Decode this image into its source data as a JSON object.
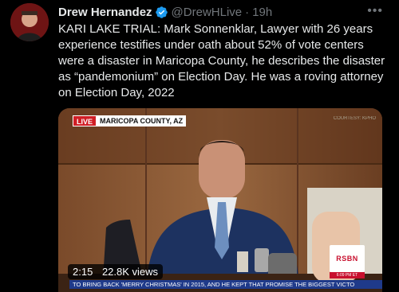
{
  "author": {
    "name": "Drew Hernandez",
    "handle": "@DrewHLive",
    "separator": "·",
    "time": "19h",
    "verified": true
  },
  "tweet": {
    "text": "KARI LAKE TRIAL: Mark Sonnenklar, Lawyer with 26 years experience testifies under oath about 52% of vote centers were a disaster in Maricopa County, he describes the disaster as “pandemonium” on Election Day. He was a roving attorney on Election Day, 2022"
  },
  "media": {
    "live_label": "LIVE",
    "location_label": "MARICOPA COUNTY, AZ",
    "courtesy": "COURTESY: KPHO",
    "network_logo": "RSBN",
    "network_time": "6:09 PM ET",
    "ticker": "TO BRING BACK 'MERRY CHRISTMAS' IN 2015, AND HE KEPT THAT PROMISE   THE BIGGEST VICTO",
    "duration": "2:15",
    "views": "22.8K views"
  },
  "icons": {
    "more": "more-icon",
    "verified": "verified-badge-icon"
  },
  "colors": {
    "background": "#000000",
    "text": "#e7e9ea",
    "muted": "#71767b",
    "verified": "#1d9bf0",
    "live_red": "#d01f26"
  }
}
